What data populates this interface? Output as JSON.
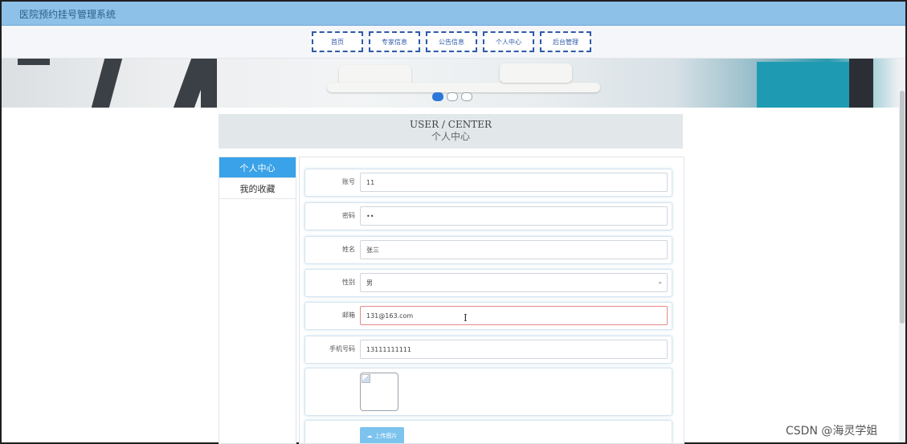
{
  "app": {
    "title": "医院预约挂号管理系统"
  },
  "nav": {
    "items": [
      {
        "label": "首页"
      },
      {
        "label": "专家信息"
      },
      {
        "label": "公告信息"
      },
      {
        "label": "个人中心"
      },
      {
        "label": "后台管理"
      }
    ]
  },
  "banner": {
    "active_slide": 1,
    "slide_count": 3
  },
  "headline": {
    "en": "USER / CENTER",
    "cn": "个人中心"
  },
  "sidebar": {
    "items": [
      {
        "label": "个人中心",
        "active": true
      },
      {
        "label": "我的收藏",
        "active": false
      }
    ]
  },
  "form": {
    "fields": [
      {
        "label": "账号",
        "value": "11"
      },
      {
        "label": "密码",
        "value": "••"
      },
      {
        "label": "姓名",
        "value": "张三"
      },
      {
        "label": "性别",
        "value": "男"
      },
      {
        "label": "邮箱",
        "value": "131@163.com"
      },
      {
        "label": "手机号码",
        "value": "13111111111"
      }
    ],
    "upload_label": "上传图片"
  },
  "watermark": "CSDN @海灵学姐",
  "colors": {
    "topbar": "#8ec1e8",
    "accent": "#3aa2e8",
    "nav_border": "#2f5aa8"
  }
}
